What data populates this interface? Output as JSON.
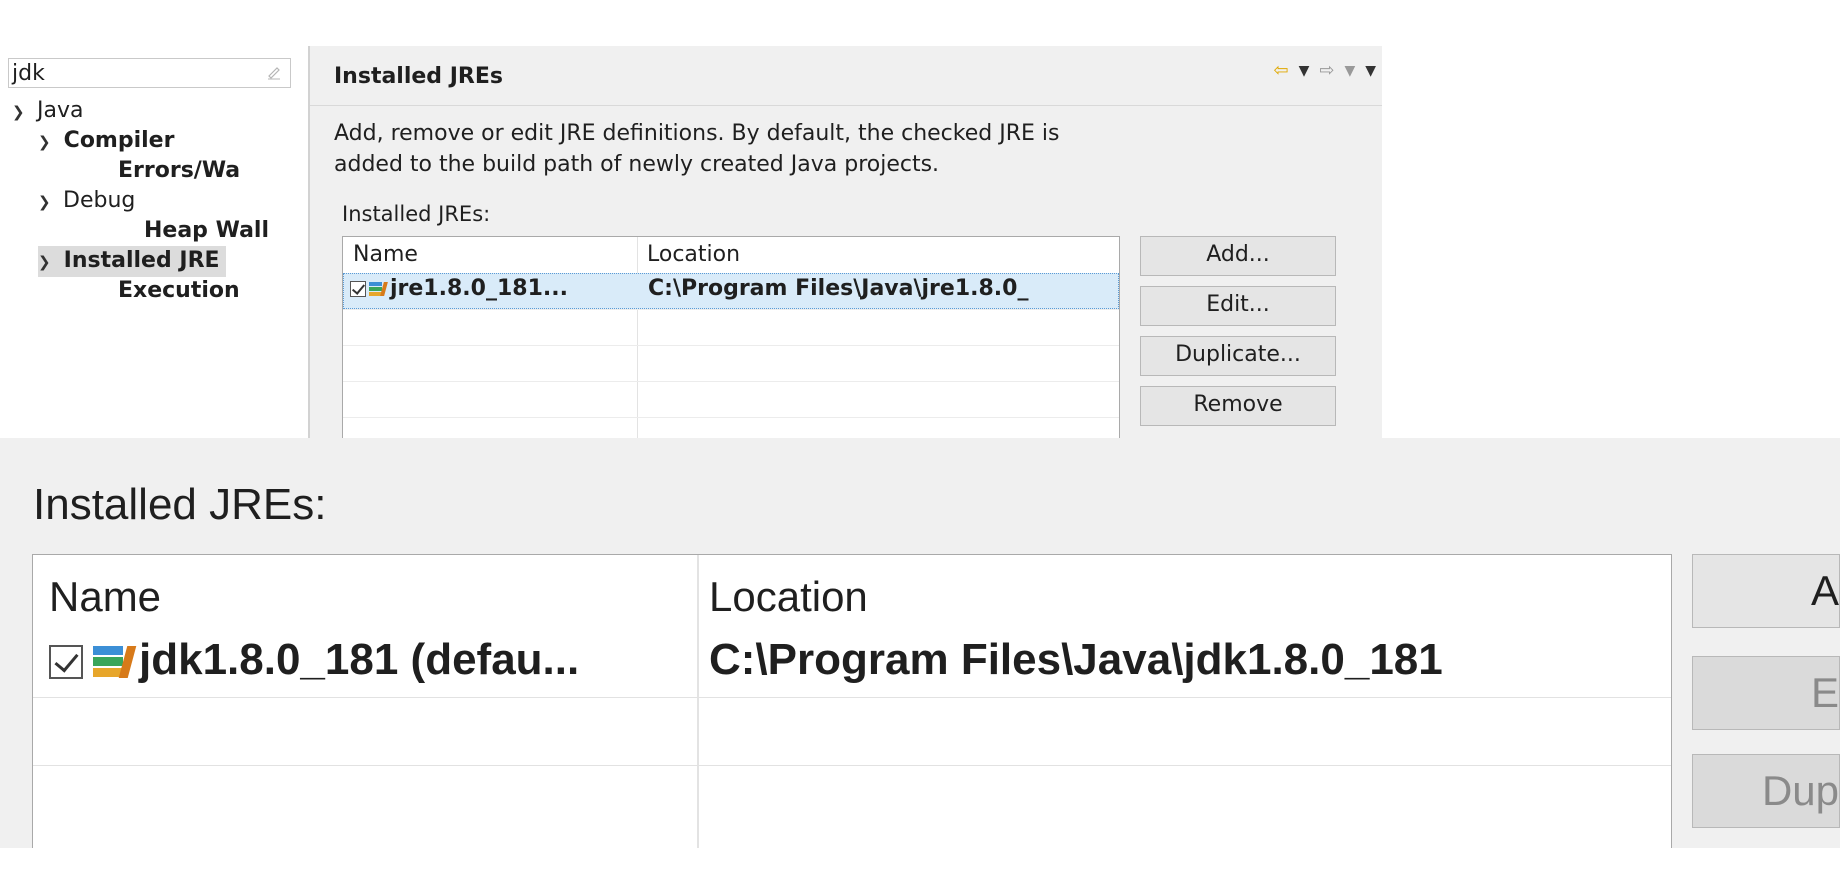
{
  "filter": {
    "value": "jdk"
  },
  "tree": {
    "items": [
      {
        "label": "Java"
      },
      {
        "label": "Compiler"
      },
      {
        "label": "Errors/Wa"
      },
      {
        "label": "Debug"
      },
      {
        "label": "Heap Wall"
      },
      {
        "label": "Installed JRE"
      },
      {
        "label": "Execution"
      }
    ]
  },
  "page": {
    "title": "Installed JREs",
    "description_line1": "Add, remove or edit JRE definitions. By default, the checked JRE is",
    "description_line2": "added to the build path of newly created Java projects.",
    "table_label": "Installed JREs:",
    "columns": [
      "Name",
      "Location"
    ],
    "rows": [
      {
        "name": "jre1.8.0_181...",
        "location": "C:\\Program Files\\Java\\jre1.8.0_",
        "checked": true
      }
    ],
    "buttons": {
      "add": "Add...",
      "edit": "Edit...",
      "duplicate": "Duplicate...",
      "remove": "Remove"
    }
  },
  "zoom": {
    "table_label": "Installed JREs:",
    "columns": [
      "Name",
      "Location"
    ],
    "rows": [
      {
        "name": "jdk1.8.0_181 (defau...",
        "location": "C:\\Program Files\\Java\\jdk1.8.0_181",
        "checked": true
      }
    ],
    "buttons": {
      "add": "A",
      "edit": "E",
      "duplicate": "Dup"
    }
  },
  "icons": {
    "nav": [
      "back-arrow-icon",
      "dropdown-icon",
      "forward-arrow-icon",
      "dropdown-icon",
      "menu-dropdown-icon"
    ],
    "accent_back": "#e0a800",
    "selection_bg": "#d9ebf9"
  }
}
